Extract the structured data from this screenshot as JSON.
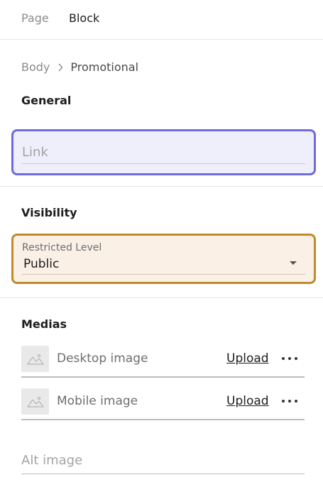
{
  "tabs": [
    {
      "label": "Page",
      "active": false
    },
    {
      "label": "Block",
      "active": true
    }
  ],
  "breadcrumb": {
    "root": "Body",
    "current": "Promotional"
  },
  "general": {
    "title": "General",
    "link_placeholder": "Link"
  },
  "visibility": {
    "title": "Visibility",
    "field_label": "Restricted Level",
    "selected": "Public"
  },
  "medias": {
    "title": "Medias",
    "items": [
      {
        "label": "Desktop image",
        "action": "Upload"
      },
      {
        "label": "Mobile image",
        "action": "Upload"
      }
    ],
    "alt_placeholder": "Alt image"
  },
  "colors": {
    "link_focus": "#6f6bdc",
    "select_focus": "#c08a2d"
  }
}
